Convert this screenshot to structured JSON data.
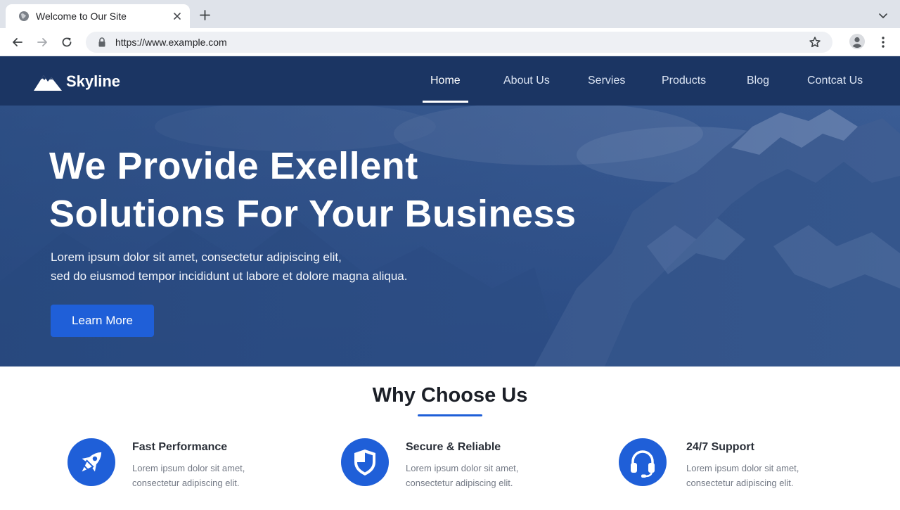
{
  "browser": {
    "tab_title": "Welcome to Our Site",
    "url": "https://www.example.com"
  },
  "site": {
    "brand": "Skyline",
    "nav": [
      {
        "label": "Home",
        "active": true
      },
      {
        "label": "About Us"
      },
      {
        "label": "Servies"
      },
      {
        "label": "Products"
      },
      {
        "label": "Blog"
      },
      {
        "label": "Contcat Us"
      }
    ],
    "hero": {
      "title_line1": "We Provide Exellent",
      "title_line2": "Solutions For Your Business",
      "subtitle_line1": "Lorem ipsum dolor sit amet, consectetur adipiscing elit,",
      "subtitle_line2": "sed do eiusmod tempor incididunt ut labore et dolore magna aliqua.",
      "cta_label": "Learn More"
    },
    "why": {
      "title": "Why Choose Us",
      "features": [
        {
          "icon": "rocket-icon",
          "title": "Fast Performance",
          "desc_line1": "Lorem ipsum dolor sit amet,",
          "desc_line2": "consectetur adipiscing elit."
        },
        {
          "icon": "shield-icon",
          "title": "Secure & Reliable",
          "desc_line1": "Lorem ipsum dolor sit amet,",
          "desc_line2": "consectetur adipiscing elit."
        },
        {
          "icon": "headset-icon",
          "title": "24/7 Support",
          "desc_line1": "Lorem ipsum dolor sit amet,",
          "desc_line2": "consectetur adipiscing elit."
        }
      ]
    }
  },
  "colors": {
    "header_bg": "#1b3563",
    "hero_bg": "#2d4f88",
    "accent": "#1f5fd8",
    "chrome_bg": "#dfe3ea"
  }
}
